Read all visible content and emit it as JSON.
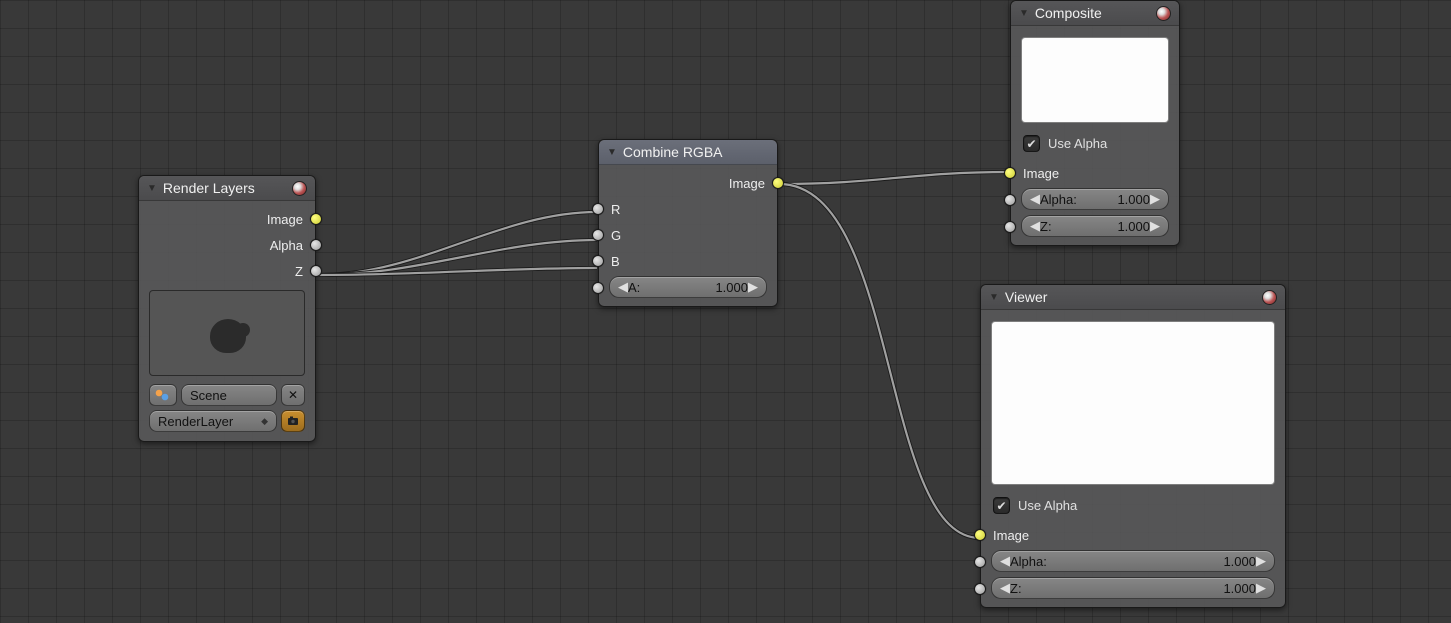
{
  "nodes": {
    "render_layers": {
      "title": "Render Layers",
      "outputs": {
        "image": "Image",
        "alpha": "Alpha",
        "z": "Z"
      },
      "scene_field": "Scene",
      "layer_field": "RenderLayer"
    },
    "combine_rgba": {
      "title": "Combine RGBA",
      "output": "Image",
      "inputs": {
        "r": "R",
        "g": "G",
        "b": "B"
      },
      "a_label": "A:",
      "a_value": "1.000"
    },
    "composite": {
      "title": "Composite",
      "use_alpha": "Use Alpha",
      "input_image": "Image",
      "alpha_label": "Alpha:",
      "alpha_value": "1.000",
      "z_label": "Z:",
      "z_value": "1.000"
    },
    "viewer": {
      "title": "Viewer",
      "use_alpha": "Use Alpha",
      "input_image": "Image",
      "alpha_label": "Alpha:",
      "alpha_value": "1.000",
      "z_label": "Z:",
      "z_value": "1.000"
    }
  }
}
